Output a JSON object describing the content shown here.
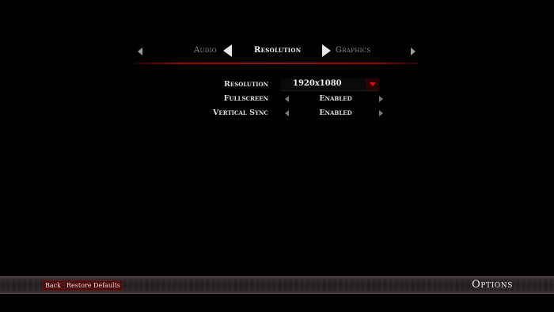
{
  "tabs": {
    "previous": "Audio",
    "current": "Resolution",
    "next": "Graphics"
  },
  "settings": [
    {
      "label": "Resolution",
      "value": "1920x1080",
      "control": "dropdown"
    },
    {
      "label": "Fullscreen",
      "value": "Enabled",
      "control": "stepper"
    },
    {
      "label": "Vertical Sync",
      "value": "Enabled",
      "control": "stepper"
    }
  ],
  "footer": {
    "back_label": "Back",
    "restore_label": "Restore Defaults",
    "screen_title": "Options"
  },
  "colors": {
    "background": "#000000",
    "accent_red": "#9b0f0f",
    "dropdown_arrow": "#e01010",
    "button_bg": "#4a0808"
  },
  "icons": {
    "tab_prev": "caret-left-icon",
    "tab_next": "caret-right-icon",
    "dropdown": "chevron-down-icon",
    "stepper_left": "arrow-left-icon",
    "stepper_right": "arrow-right-icon"
  }
}
